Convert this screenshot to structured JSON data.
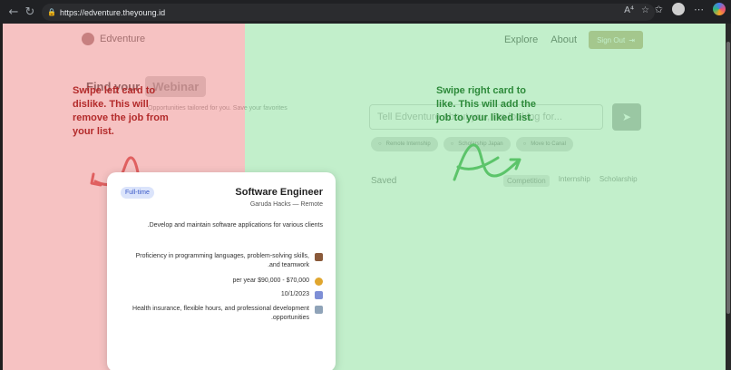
{
  "browser": {
    "url": "https://edventure.theyoung.id",
    "back_icon": "arrow-left-icon",
    "reload_icon": "reload-icon"
  },
  "site": {
    "brand": "Edventure",
    "nav": [
      "Explore",
      "About"
    ],
    "signout_label": "Sign Out",
    "tabs": [
      "Find your",
      "Webinar"
    ],
    "subtitle": "Opportunities tailored for you. Save your favorites",
    "search_placeholder": "Tell Edventure about you, I'm looking for...",
    "chips": [
      "Remote Internship",
      "Scholarship Japan",
      "Move to Canal"
    ],
    "saved_label": "Saved",
    "saved_tabs": [
      "Competition",
      "Internship",
      "Scholarship"
    ]
  },
  "overlay": {
    "left_hint": "Swipe left card to dislike. This will remove the job from your list.",
    "right_hint": "Swipe right card to like. This will add the job to your liked list.",
    "left_color": "#b32a2a",
    "right_color": "#2d8a3a"
  },
  "card": {
    "badge": "Full-time",
    "title": "Software Engineer",
    "company": "Garuda Hacks — Remote",
    "description": "Develop and maintain software applications for various clients.",
    "details": [
      {
        "icon": "briefcase-icon",
        "text": "Proficiency in programming languages, problem-solving skills, and teamwork."
      },
      {
        "icon": "money-bag-icon",
        "text": "$70,000 - $90,000 per year"
      },
      {
        "icon": "calendar-icon",
        "text": "10/1/2023"
      },
      {
        "icon": "building-icon",
        "text": "Health insurance, flexible hours, and professional development opportunities."
      }
    ]
  }
}
